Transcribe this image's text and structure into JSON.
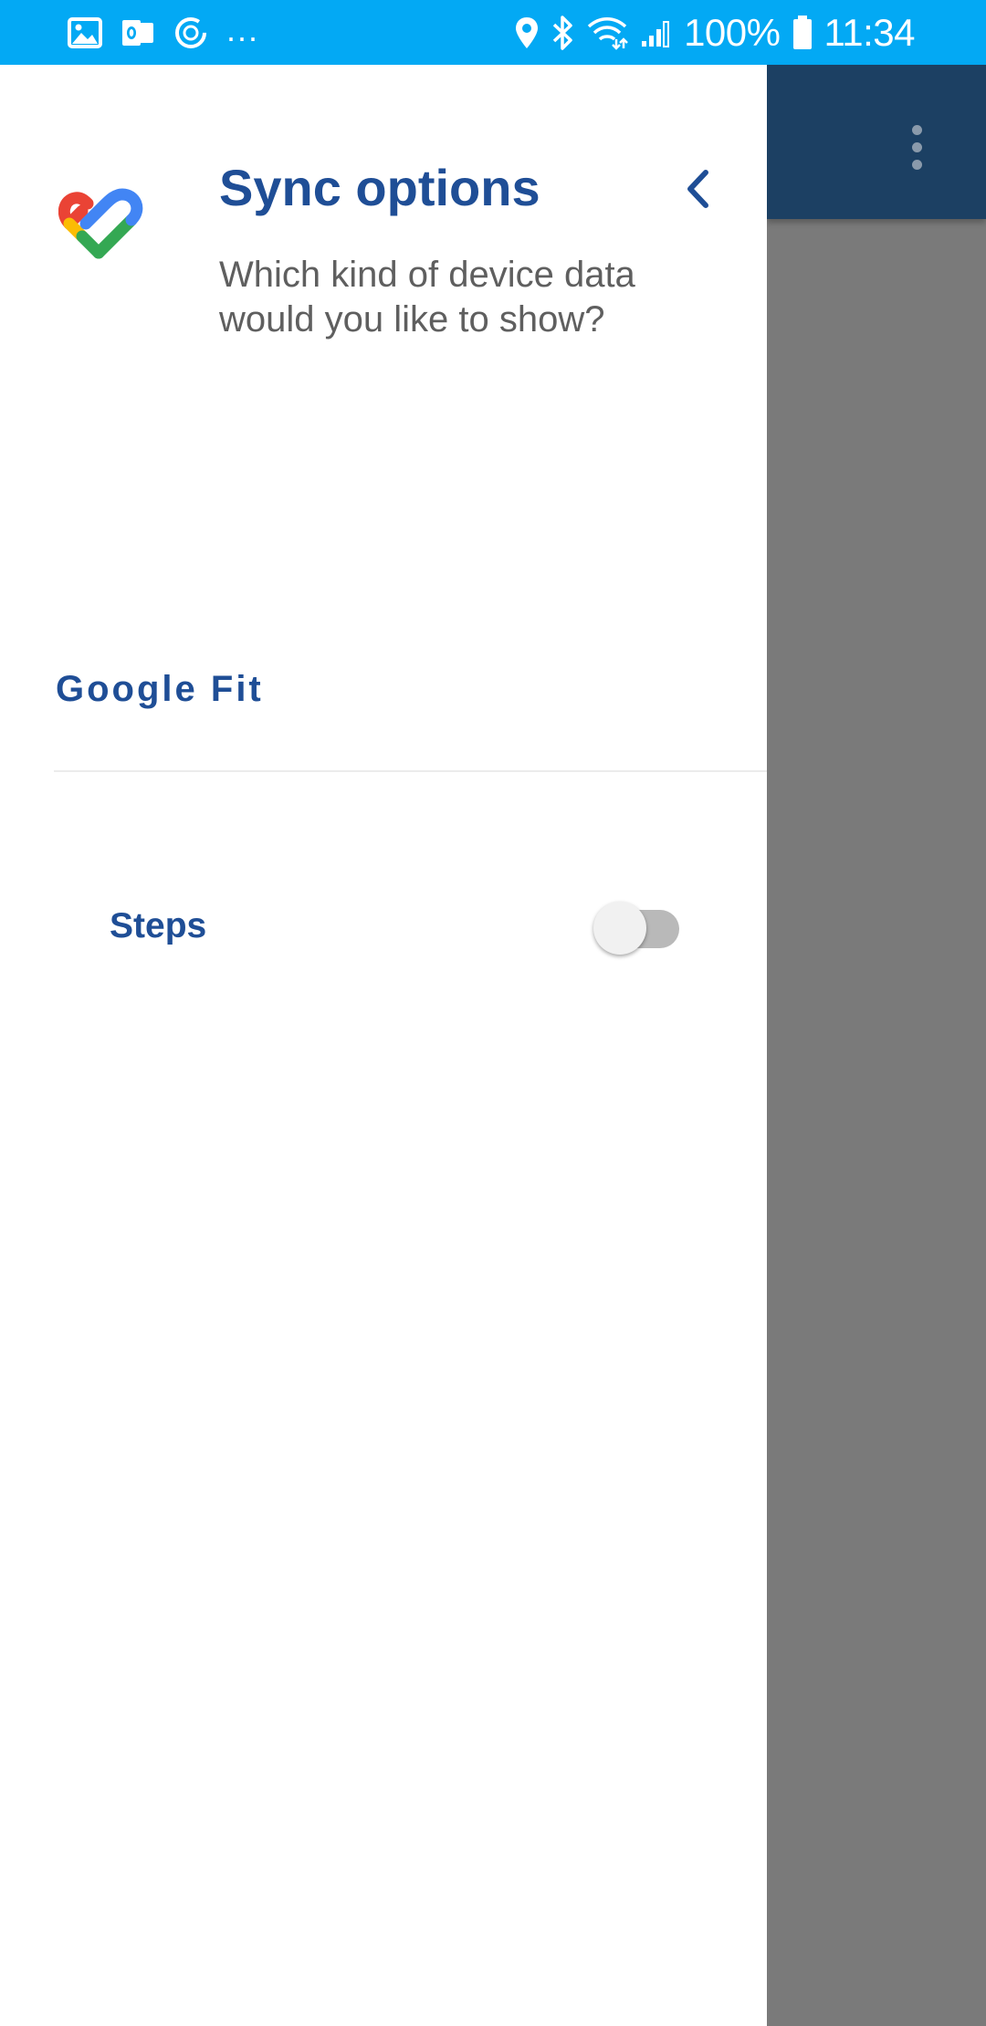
{
  "status_bar": {
    "left_icons": [
      "gallery-icon",
      "outlook-icon",
      "sync-icon"
    ],
    "overflow_text": "...",
    "right_icons": [
      "location-icon",
      "bluetooth-icon",
      "wifi-icon",
      "signal-icon"
    ],
    "battery_text": "100%",
    "time": "11:34",
    "background_color": "#03a9f4"
  },
  "drawer": {
    "title": "Sync options",
    "subtitle": "Which kind of device data would you like to show?",
    "logo_icon": "google-fit-heart-icon",
    "back_icon": "chevron-left-icon",
    "section": {
      "header": "Google Fit",
      "items": [
        {
          "label": "Steps",
          "enabled": false
        }
      ]
    },
    "accent_color": "#1f4e96"
  },
  "app_behind": {
    "toolbar_color": "#1c4063",
    "menu_icon": "more-vertical-icon",
    "scrim_color": "#7a7a7a"
  }
}
